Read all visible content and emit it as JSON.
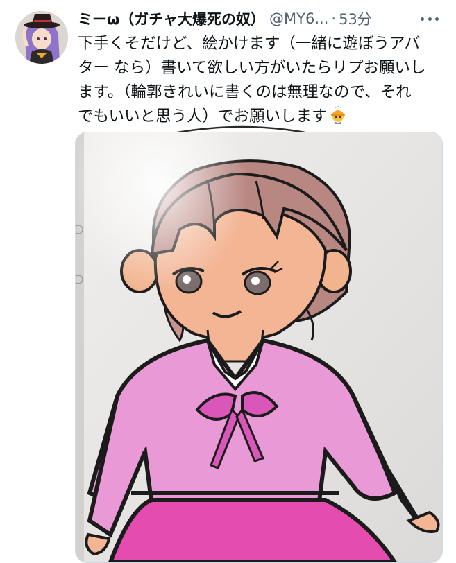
{
  "tweet": {
    "display_name": "ミーω（ガチャ大爆死の奴）",
    "handle": "@MY6...",
    "separator": "·",
    "time": "53分",
    "text_lines": [
      "下手くそだけど、絵かけます（一緒に遊ぼうアバ",
      "ター なら）書いて欲しい方がいたらリプお願いし",
      "ます。（輪郭きれいに書くのは無理なので、それ",
      "でもいいと思う人）でお願いします"
    ],
    "emoji": "construction-worker-emoji",
    "more_icon": "more-icon",
    "media_description_icon": "photo-attachment"
  },
  "colors": {
    "name": "#0f1419",
    "secondary": "#536471",
    "dress_pink": "#e99ad6",
    "skirt_magenta": "#e44cb0",
    "hair": "#b77f79",
    "skin": "#f3b594"
  }
}
